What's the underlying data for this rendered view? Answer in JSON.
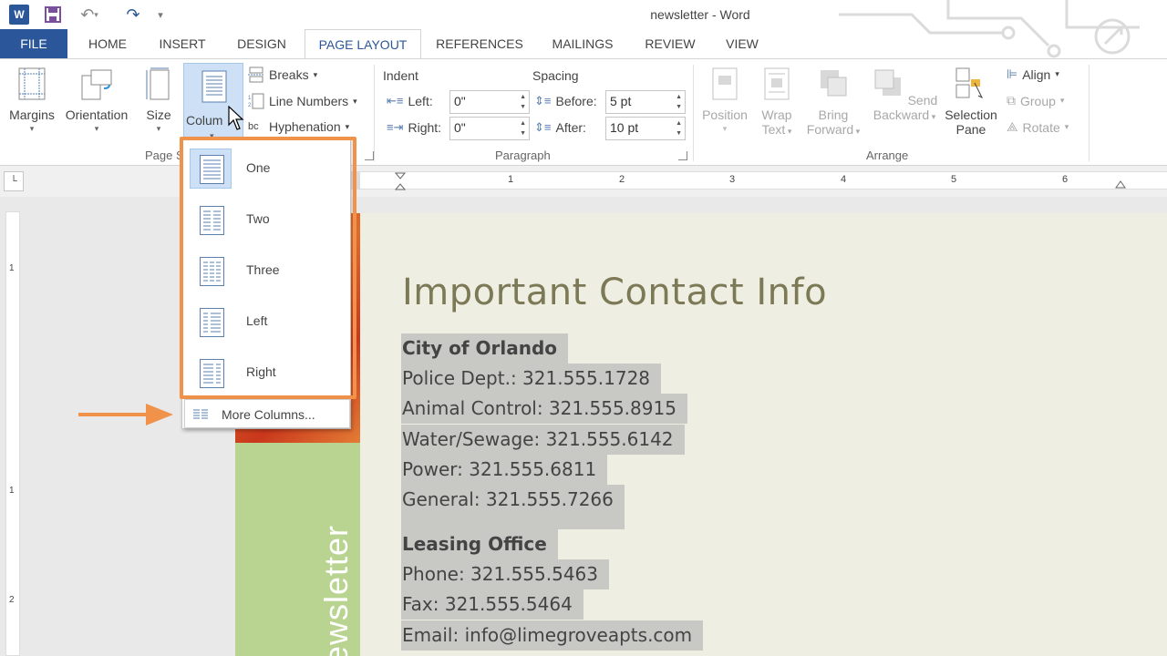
{
  "title_bar": {
    "app_icon_letter": "W",
    "window_title": "newsletter - Word"
  },
  "tabs": [
    "FILE",
    "HOME",
    "INSERT",
    "DESIGN",
    "PAGE LAYOUT",
    "REFERENCES",
    "MAILINGS",
    "REVIEW",
    "VIEW"
  ],
  "active_tab": "PAGE LAYOUT",
  "ribbon": {
    "page_setup": {
      "margins": "Margins",
      "orientation": "Orientation",
      "size": "Size",
      "columns": "Colum",
      "breaks": "Breaks",
      "line_numbers": "Line Numbers",
      "hyphenation": "Hyphenation",
      "group_label": "Page S"
    },
    "paragraph": {
      "indent_label": "Indent",
      "spacing_label": "Spacing",
      "left_label": "Left:",
      "left_value": "0\"",
      "right_label": "Right:",
      "right_value": "0\"",
      "before_label": "Before:",
      "before_value": "5 pt",
      "after_label": "After:",
      "after_value": "10 pt",
      "group_label": "Paragraph"
    },
    "arrange": {
      "position": "Position",
      "wrap_text_1": "Wrap",
      "wrap_text_2": "Text",
      "bring_forward_1": "Bring",
      "bring_forward_2": "Forward",
      "send_backward_1": "Send",
      "send_backward_2": "Backward",
      "selection_pane_1": "Selection",
      "selection_pane_2": "Pane",
      "align": "Align",
      "group": "Group",
      "rotate": "Rotate",
      "group_label": "Arrange"
    }
  },
  "columns_menu": {
    "items": [
      "One",
      "Two",
      "Three",
      "Left",
      "Right"
    ],
    "selected": "One",
    "more": "More Columns..."
  },
  "ruler": {
    "numbers": [
      "1",
      "2",
      "3",
      "4",
      "5",
      "6"
    ],
    "vertical_numbers": [
      "1",
      "1",
      "2"
    ]
  },
  "document": {
    "sidebar_text": "Newsletter",
    "heading": "Important Contact Info",
    "lines": [
      "City of Orlando",
      "Police Dept.: 321.555.1728",
      "Animal Control: 321.555.8915",
      "Water/Sewage: 321.555.6142",
      "Power: 321.555.6811",
      "General: 321.555.7266",
      "Leasing Office",
      "Phone: 321.555.5463",
      "Fax: 321.555.5464",
      "Email: info@limegroveapts.com"
    ]
  },
  "colors": {
    "word_blue": "#2b579a",
    "highlight_orange": "#f0924a",
    "heading_olive": "#7c7a56",
    "selection_gray": "#c8c8c4",
    "sidebar_green": "#b9d390"
  }
}
